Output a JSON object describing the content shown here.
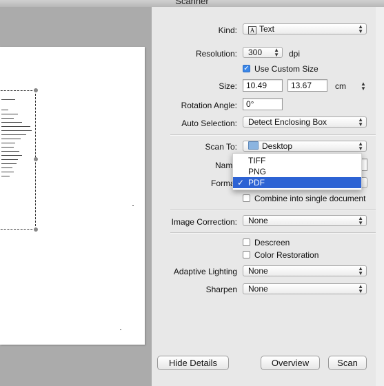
{
  "window": {
    "title": "Scanner"
  },
  "settings": {
    "kind": {
      "label": "Kind:",
      "value": "Text",
      "icon": "text-kind-icon"
    },
    "resolution": {
      "label": "Resolution:",
      "value": "300",
      "unit": "dpi"
    },
    "custom_size": {
      "label": "Use Custom Size",
      "checked": true
    },
    "size": {
      "label": "Size:",
      "width": "10.49",
      "height": "13.67",
      "unit": "cm"
    },
    "rotation": {
      "label": "Rotation Angle:",
      "value": "0°"
    },
    "auto_selection": {
      "label": "Auto Selection:",
      "value": "Detect Enclosing Box"
    },
    "scan_to": {
      "label": "Scan To:",
      "value": "Desktop",
      "icon": "folder-icon"
    },
    "name": {
      "label": "Name"
    },
    "format": {
      "label": "Format",
      "options": [
        "TIFF",
        "PNG",
        "PDF"
      ],
      "selected": "PDF",
      "check": "✓"
    },
    "combine": {
      "label": "Combine into single document",
      "checked": false
    },
    "image_correction": {
      "label": "Image Correction:",
      "value": "None"
    },
    "descreen": {
      "label": "Descreen",
      "checked": false
    },
    "color_restoration": {
      "label": "Color Restoration",
      "checked": false
    },
    "adaptive_lighting": {
      "label": "Adaptive Lighting",
      "value": "None"
    },
    "sharpen": {
      "label": "Sharpen",
      "value": "None"
    }
  },
  "buttons": {
    "hide_details": "Hide Details",
    "overview": "Overview",
    "scan": "Scan"
  },
  "colors": {
    "selection": "#2d63d4",
    "checkbox_checked": "#3b87e8"
  }
}
